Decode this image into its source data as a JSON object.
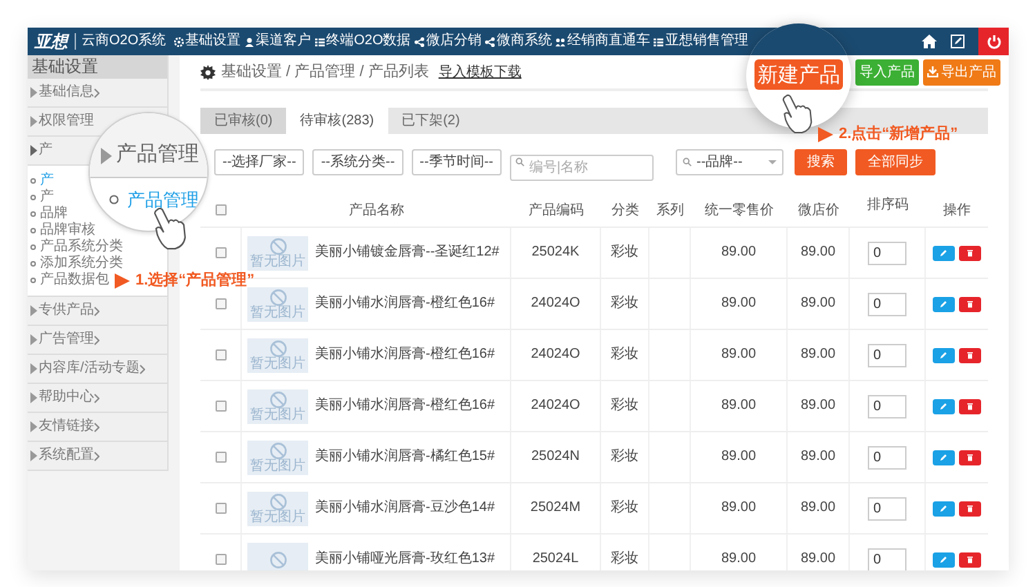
{
  "nav": {
    "logo": "亚想",
    "system_name": "云商O2O系统",
    "menu": [
      "基础设置",
      "渠道客户",
      "终端O2O数据",
      "微店分销",
      "微商系统",
      "经销商直通车",
      "亚想销售管理"
    ]
  },
  "sidebar": {
    "title": "基础设置",
    "items": [
      {
        "label": "基础信息",
        "expanded": false
      },
      {
        "label": "权限管理",
        "expanded": false
      },
      {
        "label": "产",
        "expanded": true,
        "children": [
          {
            "label": "产",
            "selected": true
          },
          {
            "label": "产",
            "selected": false
          },
          {
            "label": "品牌",
            "selected": false
          },
          {
            "label": "品牌审核",
            "selected": false
          },
          {
            "label": "产品系统分类",
            "selected": false
          },
          {
            "label": "添加系统分类",
            "selected": false
          },
          {
            "label": "产品数据包",
            "selected": false
          }
        ]
      },
      {
        "label": "专供产品",
        "expanded": false
      },
      {
        "label": "广告管理",
        "expanded": false
      },
      {
        "label": "内容库/活动专题",
        "expanded": false
      },
      {
        "label": "帮助中心",
        "expanded": false
      },
      {
        "label": "友情链接",
        "expanded": false
      },
      {
        "label": "系统配置",
        "expanded": false
      }
    ]
  },
  "breadcrumb": "基础设置 / 产品管理 / 产品列表",
  "template_link": "导入模板下载",
  "actions": [
    {
      "label": "导入产品",
      "kind": "import"
    },
    {
      "label": "导出产品",
      "kind": "export"
    }
  ],
  "tabs": [
    {
      "label": "已审核(0)",
      "selected": false
    },
    {
      "label": "待审核(283)",
      "selected": true
    },
    {
      "label": "已下架(2)",
      "selected": false
    }
  ],
  "filters": [
    {
      "kind": "select",
      "value": "--选择厂家--"
    },
    {
      "kind": "select",
      "value": "--系统分类--"
    },
    {
      "kind": "select",
      "value": "--季节时间--"
    },
    {
      "kind": "search",
      "placeholder": "编号|名称"
    },
    {
      "kind": "search-select",
      "value": "--品牌--"
    }
  ],
  "filter_buttons": [
    "搜索",
    "全部同步"
  ],
  "table": {
    "all_checked": false,
    "columns": [
      "产品名称",
      "产品编码",
      "分类",
      "系列",
      "统一零售价",
      "微店价",
      "排序码",
      "操作"
    ],
    "rows": [
      {
        "checked": false,
        "image": "暂无图片",
        "name": "美丽小铺镀金唇膏--圣诞红12#",
        "code": "25024K",
        "category": "彩妆",
        "retail_price": "89.00",
        "shop_price": "89.00",
        "sort": "0"
      },
      {
        "checked": false,
        "image": "暂无图片",
        "name": "美丽小铺水润唇膏-橙红色16#",
        "code": "24024O",
        "category": "彩妆",
        "retail_price": "89.00",
        "shop_price": "89.00",
        "sort": "0"
      },
      {
        "checked": false,
        "image": "暂无图片",
        "name": "美丽小铺水润唇膏-橙红色16#",
        "code": "24024O",
        "category": "彩妆",
        "retail_price": "89.00",
        "shop_price": "89.00",
        "sort": "0"
      },
      {
        "checked": false,
        "image": "暂无图片",
        "name": "美丽小铺水润唇膏-橙红色16#",
        "code": "24024O",
        "category": "彩妆",
        "retail_price": "89.00",
        "shop_price": "89.00",
        "sort": "0"
      },
      {
        "checked": false,
        "image": "暂无图片",
        "name": "美丽小铺水润唇膏-橘红色15#",
        "code": "25024N",
        "category": "彩妆",
        "retail_price": "89.00",
        "shop_price": "89.00",
        "sort": "0"
      },
      {
        "checked": false,
        "image": "暂无图片",
        "name": "美丽小铺水润唇膏-豆沙色14#",
        "code": "25024M",
        "category": "彩妆",
        "retail_price": "89.00",
        "shop_price": "89.00",
        "sort": "0"
      },
      {
        "checked": false,
        "name": "美丽小铺哑光唇膏-玫红色13#",
        "code": "25024L",
        "category": "彩妆",
        "retail_price": "89.00",
        "shop_price": "89.00",
        "sort": "0"
      }
    ]
  },
  "tutorial": {
    "magnifier_1": {
      "heading": "产品管理",
      "item": "产品管理"
    },
    "step_1": "1.选择“产品管理”",
    "magnifier_2": {
      "button": "新建产品"
    },
    "step_2": "2.点击“新增产品”"
  }
}
